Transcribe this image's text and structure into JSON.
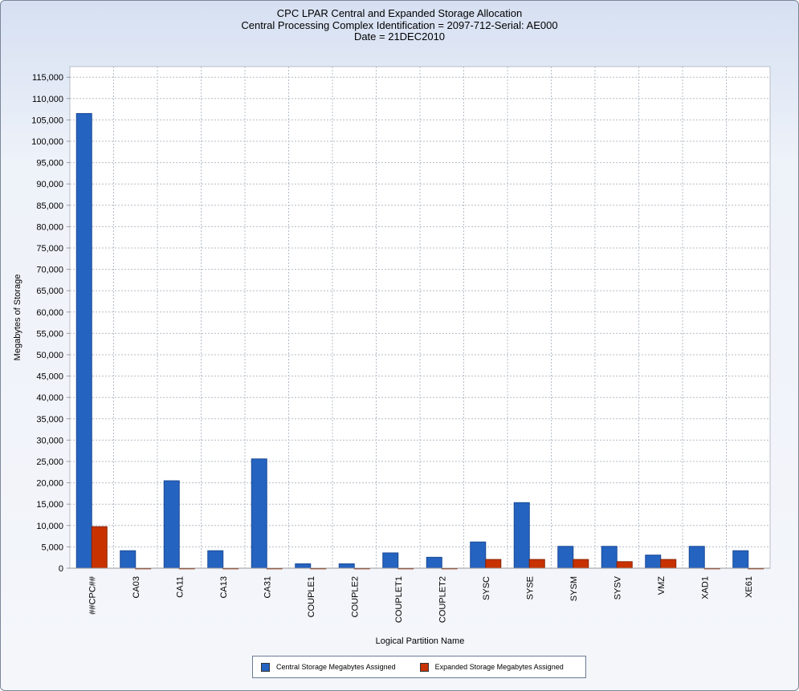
{
  "chart_data": {
    "type": "bar",
    "title": "CPC LPAR Central and Expanded Storage Allocation",
    "subtitle": "Central Processing Complex Identification = 2097-712-Serial: AE000",
    "subtitle2": "Date = 21DEC2010",
    "xlabel": "Logical Partition Name",
    "ylabel": "Megabytes of Storage",
    "ylim": [
      0,
      117000
    ],
    "yticks": [
      0,
      5000,
      10000,
      15000,
      20000,
      25000,
      30000,
      35000,
      40000,
      45000,
      50000,
      55000,
      60000,
      65000,
      70000,
      75000,
      80000,
      85000,
      90000,
      95000,
      100000,
      105000,
      110000,
      115000
    ],
    "grid": true,
    "legend_position": "bottom",
    "categories": [
      "##CPC##",
      "CA03",
      "CA11",
      "CA13",
      "CA31",
      "COUPLE1",
      "COUPLE2",
      "COUPLET1",
      "COUPLET2",
      "SYSC",
      "SYSE",
      "SYSM",
      "SYSV",
      "VMZ",
      "XAD1",
      "XE61"
    ],
    "series": [
      {
        "name": "Central Storage Megabytes Assigned",
        "color": "#2563c0",
        "values": [
          106496,
          4096,
          20480,
          4096,
          25600,
          1024,
          1024,
          3584,
          2560,
          6144,
          15360,
          5120,
          5120,
          3072,
          5120,
          4096
        ]
      },
      {
        "name": "Expanded Storage Megabytes Assigned",
        "color": "#c83200",
        "values": [
          9728,
          0,
          0,
          0,
          0,
          0,
          0,
          0,
          0,
          2048,
          2048,
          2048,
          1536,
          2048,
          0,
          0
        ]
      }
    ]
  }
}
